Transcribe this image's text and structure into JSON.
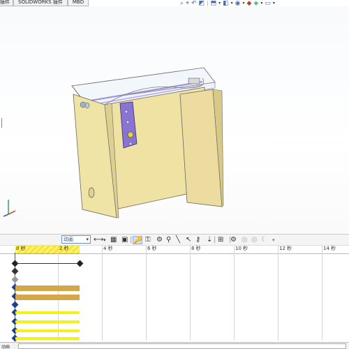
{
  "tabs": [
    "插件",
    "SOLIDWORKS 插件",
    "MBD"
  ],
  "hud_icons": [
    "search-zoom-icon",
    "zoom-area-icon",
    "previous-view-icon",
    "section-view-icon",
    "view-orientation-icon",
    "display-style-icon",
    "hide-show-icon",
    "edit-appearance-icon",
    "apply-scene-icon",
    "view-settings-icon"
  ],
  "motion": {
    "study_type": "动画",
    "timeline_labels": [
      "0 秒",
      "2 秒",
      "4 秒",
      "6 秒",
      "8 秒",
      "10 秒",
      "12 秒",
      "14 秒"
    ],
    "selected_interval_seconds": [
      0,
      3
    ]
  },
  "status": {
    "label": "动画",
    "value": ""
  },
  "colors": {
    "part": "#f0e3a6",
    "bracket": "#8a74d2",
    "gold_bar": "#d4a84a",
    "yellow_bar": "#f5f01a",
    "accent": "#3d6fb5"
  }
}
